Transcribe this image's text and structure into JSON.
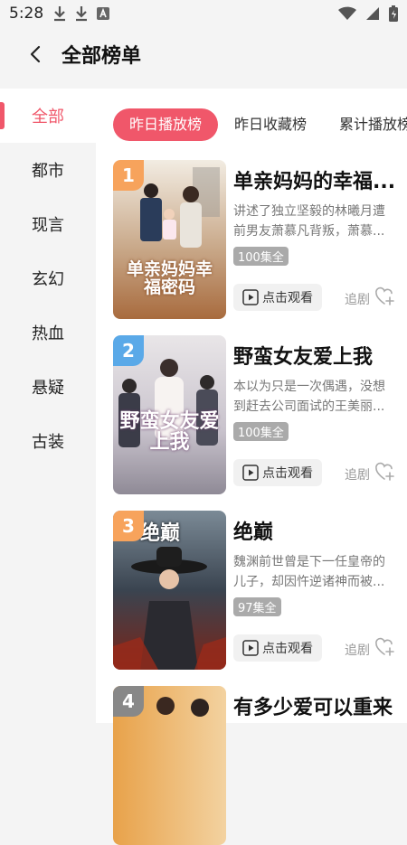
{
  "status_bar": {
    "time": "5:28",
    "left_icons": [
      "download-icon",
      "download-icon",
      "app-icon"
    ],
    "right_icons": [
      "wifi-icon",
      "signal-icon",
      "battery-icon"
    ]
  },
  "header": {
    "title": "全部榜单",
    "back_icon": "back-arrow-icon"
  },
  "sidebar": {
    "items": [
      {
        "label": "全部",
        "selected": true
      },
      {
        "label": "都市"
      },
      {
        "label": "现言"
      },
      {
        "label": "玄幻"
      },
      {
        "label": "热血"
      },
      {
        "label": "悬疑"
      },
      {
        "label": "古装"
      }
    ]
  },
  "tabs": [
    {
      "label": "昨日播放榜",
      "selected": true
    },
    {
      "label": "昨日收藏榜"
    },
    {
      "label": "累计播放榜"
    }
  ],
  "colors": {
    "accent": "#f0576a",
    "sidebar_bg": "#f4f4f4",
    "rank_1_3": "#f7a35c",
    "rank_other": "#888888"
  },
  "list": [
    {
      "rank": "1",
      "title": "单亲妈妈的幸福...",
      "desc": "讲述了独立坚毅的林曦月遭前男友萧慕凡背叛，萧慕...",
      "episodes": "100集全",
      "watch_label": "点击观看",
      "follow_label": "追剧",
      "poster_text": "单亲妈妈幸福密码"
    },
    {
      "rank": "2",
      "title": "野蛮女友爱上我",
      "desc": "本以为只是一次偶遇，没想到赶去公司面试的王美丽...",
      "episodes": "100集全",
      "watch_label": "点击观看",
      "follow_label": "追剧",
      "poster_text": "野蛮女友爱上我"
    },
    {
      "rank": "3",
      "title": "绝巅",
      "desc": "魏渊前世曾是下一任皇帝的儿子，却因忤逆诸神而被...",
      "episodes": "97集全",
      "watch_label": "点击观看",
      "follow_label": "追剧",
      "poster_text": "绝巅"
    },
    {
      "rank": "4",
      "title": "有多少爱可以重来",
      "desc": "",
      "episodes": "",
      "watch_label": "",
      "follow_label": "",
      "poster_text": ""
    }
  ]
}
